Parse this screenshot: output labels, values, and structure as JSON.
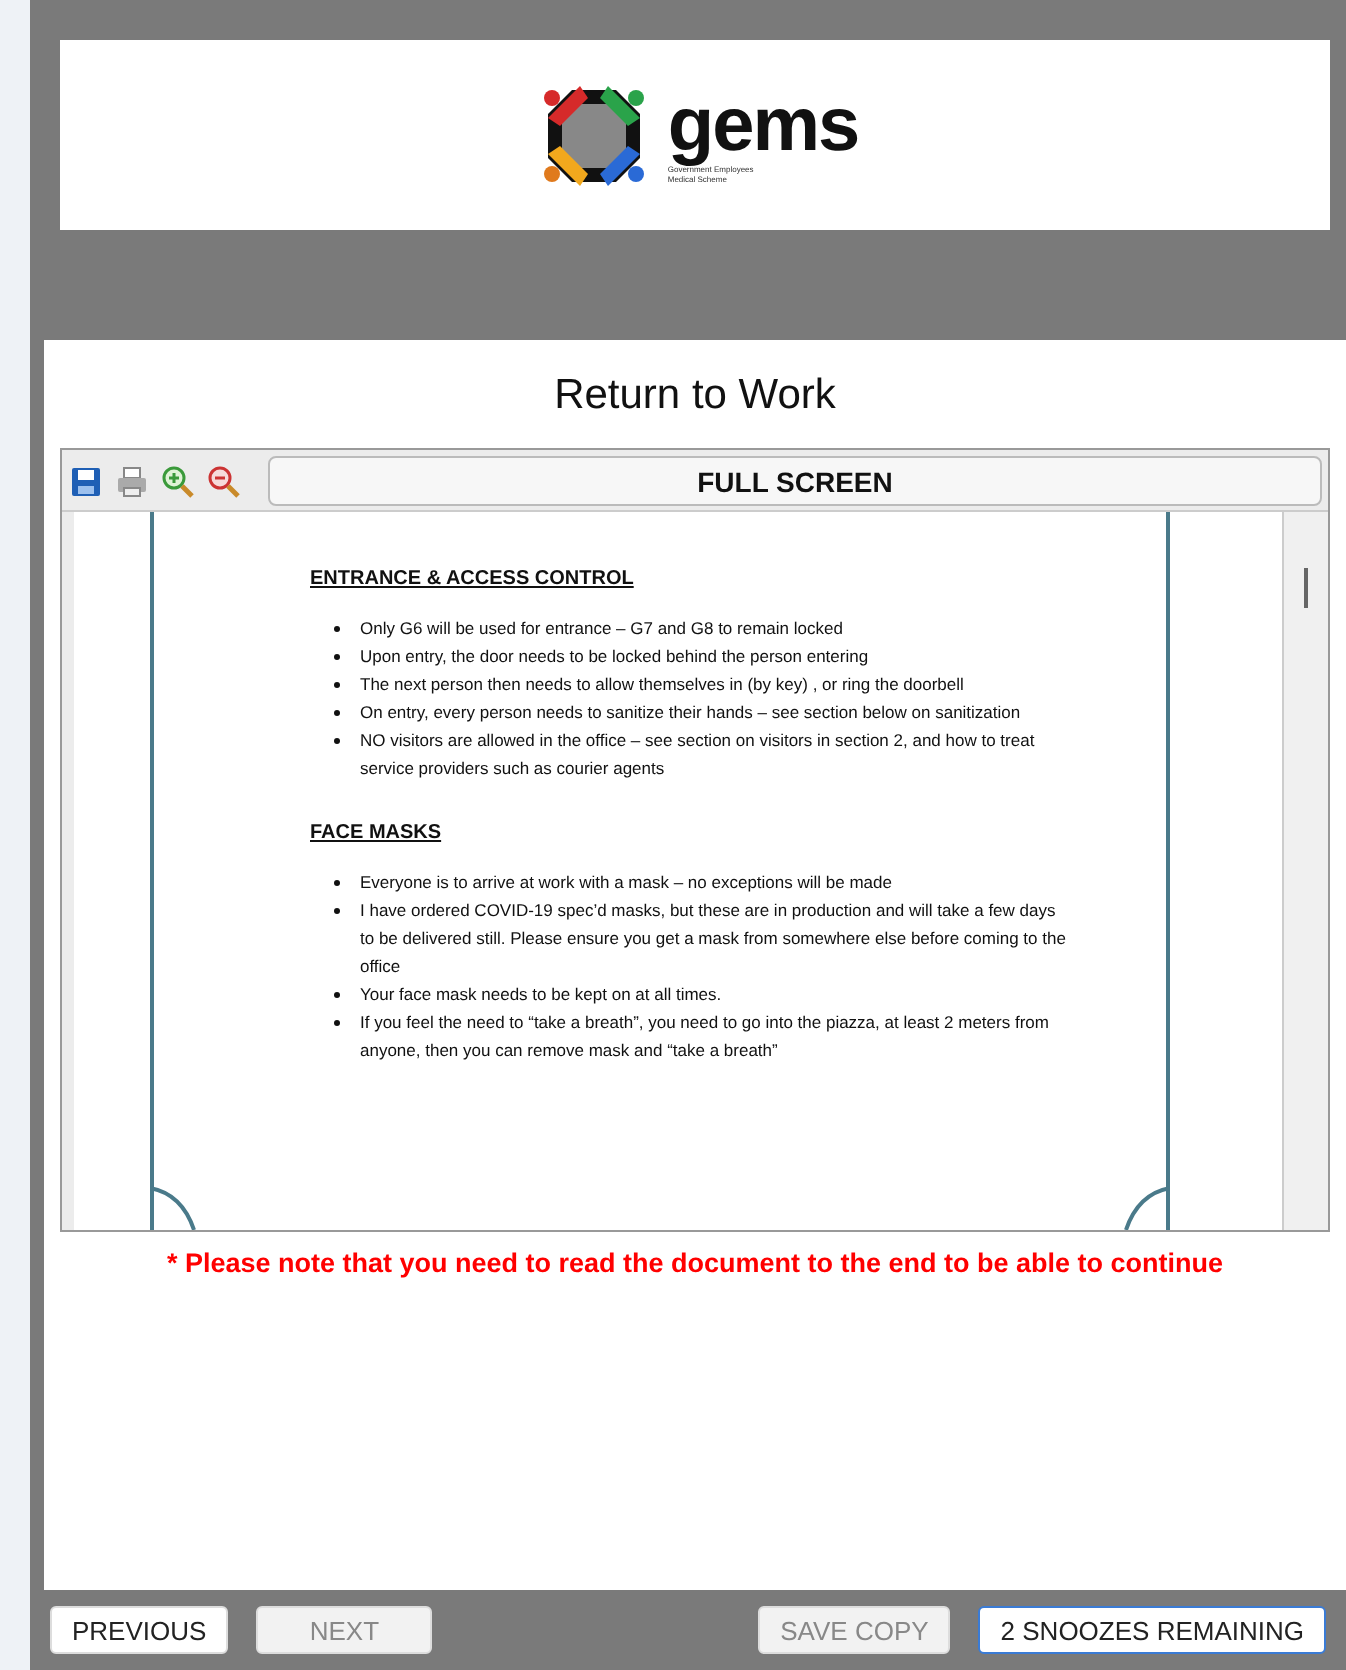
{
  "logo": {
    "wordmark": "gems",
    "tagline": [
      "Government Employees",
      "Medical Scheme"
    ]
  },
  "title": "Return to Work",
  "viewer": {
    "full_screen_label": "FULL SCREEN",
    "sections": [
      {
        "heading": "ENTRANCE & ACCESS CONTROL",
        "bullets": [
          "Only G6 will be used for entrance – G7 and G8 to remain locked",
          "Upon entry, the door needs to be locked behind the person entering",
          "The next person then needs to allow themselves in (by key) , or ring the doorbell",
          "On entry, every person needs to sanitize their hands – see section below on sanitization",
          "NO visitors are allowed in the office – see section on visitors in section 2, and how to treat service providers such as courier agents"
        ]
      },
      {
        "heading": "FACE MASKS",
        "bullets": [
          "Everyone is to arrive at work with a mask – no exceptions will be made",
          "I have ordered COVID-19 spec’d masks, but these are in production and will take a few days to be delivered still. Please ensure you get a mask from somewhere else before coming to the office",
          "Your face mask needs to be kept on at all times.",
          "If you feel the need to “take a breath”, you need to go into the piazza, at least 2 meters from anyone, then you can remove mask and “take a breath”"
        ]
      }
    ]
  },
  "note": "* Please note that you need to read the document to the end to be able to continue",
  "buttons": [
    {
      "label": "PREVIOUS",
      "disabled": false,
      "focused": false
    },
    {
      "label": "NEXT",
      "disabled": true,
      "focused": false
    },
    {
      "label": "SAVE COPY",
      "disabled": true,
      "focused": false
    },
    {
      "label": "2 SNOOZES REMAINING",
      "disabled": false,
      "focused": true
    }
  ]
}
